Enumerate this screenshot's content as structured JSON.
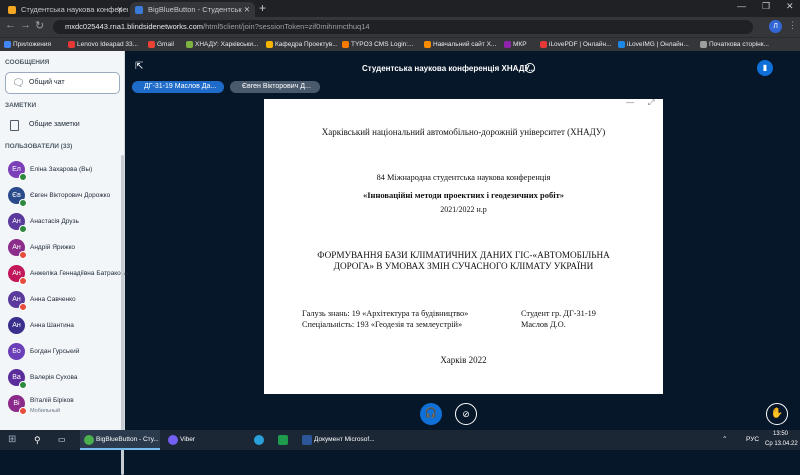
{
  "browser": {
    "tabs": [
      {
        "title": "Студентська наукова конференція",
        "favicon_color": "#f5a623"
      },
      {
        "title": "BigBlueButton - Студентськ",
        "favicon_color": "#3a7bd5"
      }
    ],
    "url_host": "mxdc025443.rna1.blindsidenetworks.com",
    "url_path": "/html5client/join?sessionToken=zif0mihnmcthuq14",
    "bookmarks": [
      "Приложения",
      "Lenovo Ideapad 33...",
      "Gmail",
      "ХНАДУ: Харківськи...",
      "Кафедра Проектув...",
      "TYPO3 CMS Login:...",
      "Навчальний сайт Х...",
      "МКР",
      "iLovePDF | Онлайн...",
      "iLoveIMG | Онлайн...",
      "Початкова сторінк..."
    ],
    "profile_initial": "Л"
  },
  "sidebar": {
    "messages_header": "СООБЩЕНИЯ",
    "public_chat": "Общий чат",
    "notes_header": "ЗАМЕТКИ",
    "shared_notes": "Общие заметки",
    "users_header": "ПОЛЬЗОВАТЕЛИ (33)",
    "users": [
      {
        "initials": "Ел",
        "name": "Еліна Захарова (Вы)",
        "color": "#7b3fb8",
        "status": "mic",
        "sub": ""
      },
      {
        "initials": "Єв",
        "name": "Євген Вікторович Дорожко",
        "color": "#2a4a8c",
        "status": "mic",
        "sub": ""
      },
      {
        "initials": "Ан",
        "name": "Анастасія Друзь",
        "color": "#5a3a9c",
        "status": "mic",
        "sub": ""
      },
      {
        "initials": "Ан",
        "name": "Андрій Ярижко",
        "color": "#8c2d8c",
        "status": "muted",
        "sub": ""
      },
      {
        "initials": "Ан",
        "name": "Анжеліка Геннадіївна Батракова",
        "color": "#c2185b",
        "status": "muted",
        "sub": ""
      },
      {
        "initials": "Ан",
        "name": "Анна Савченко",
        "color": "#5a3a9c",
        "status": "muted",
        "sub": ""
      },
      {
        "initials": "Ан",
        "name": "Анна Шантина",
        "color": "#3a2f8c",
        "status": "none",
        "sub": ""
      },
      {
        "initials": "Бо",
        "name": "Богдан Гурський",
        "color": "#6a3fb8",
        "status": "none",
        "sub": ""
      },
      {
        "initials": "Ва",
        "name": "Валерія Сухова",
        "color": "#5b2d9c",
        "status": "mic",
        "sub": ""
      },
      {
        "initials": "Ві",
        "name": "Віталій Біріков",
        "color": "#8a2a8a",
        "status": "muted",
        "sub": "Мобильный"
      }
    ]
  },
  "main": {
    "conference_title": "Студентська наукова конференція ХНАДУ...",
    "talkers": [
      "ДГ-31-19 Маслов Да...",
      "Євген Вікторович Д..."
    ]
  },
  "slide": {
    "university": "Харківський національний автомобільно-дорожній університет (ХНАДУ)",
    "conf_line": "84 Міжнародна студентська наукова конференція",
    "conf_name": "«Інноваційні методи проектних і геодезичних робіт»",
    "years": "2021/2022 н.р",
    "topic_line1": "ФОРМУВАННЯ БАЗИ КЛІМАТИЧНИХ ДАНИХ ГІС-«АВТОМОБІЛЬНА",
    "topic_line2": "ДОРОГА» В УМОВАХ ЗМІН СУЧАСНОГО КЛІМАТУ УКРАЇНИ",
    "field_label": "Галузь знань: 19 «Архітектура та будівництво»",
    "spec_label": "Спеціальність: 193 «Геодезія та землеустрій»",
    "student_label": "Студент гр. ДГ-31-19",
    "student_name": "Маслов Д.О.",
    "city_year": "Харків 2022"
  },
  "taskbar": {
    "items": [
      "BigBlueButton - Сту...",
      "Viber",
      "",
      "Документ Microsof..."
    ],
    "lang": "РУС",
    "time": "13:50",
    "date": "Ср 13.04.22"
  }
}
